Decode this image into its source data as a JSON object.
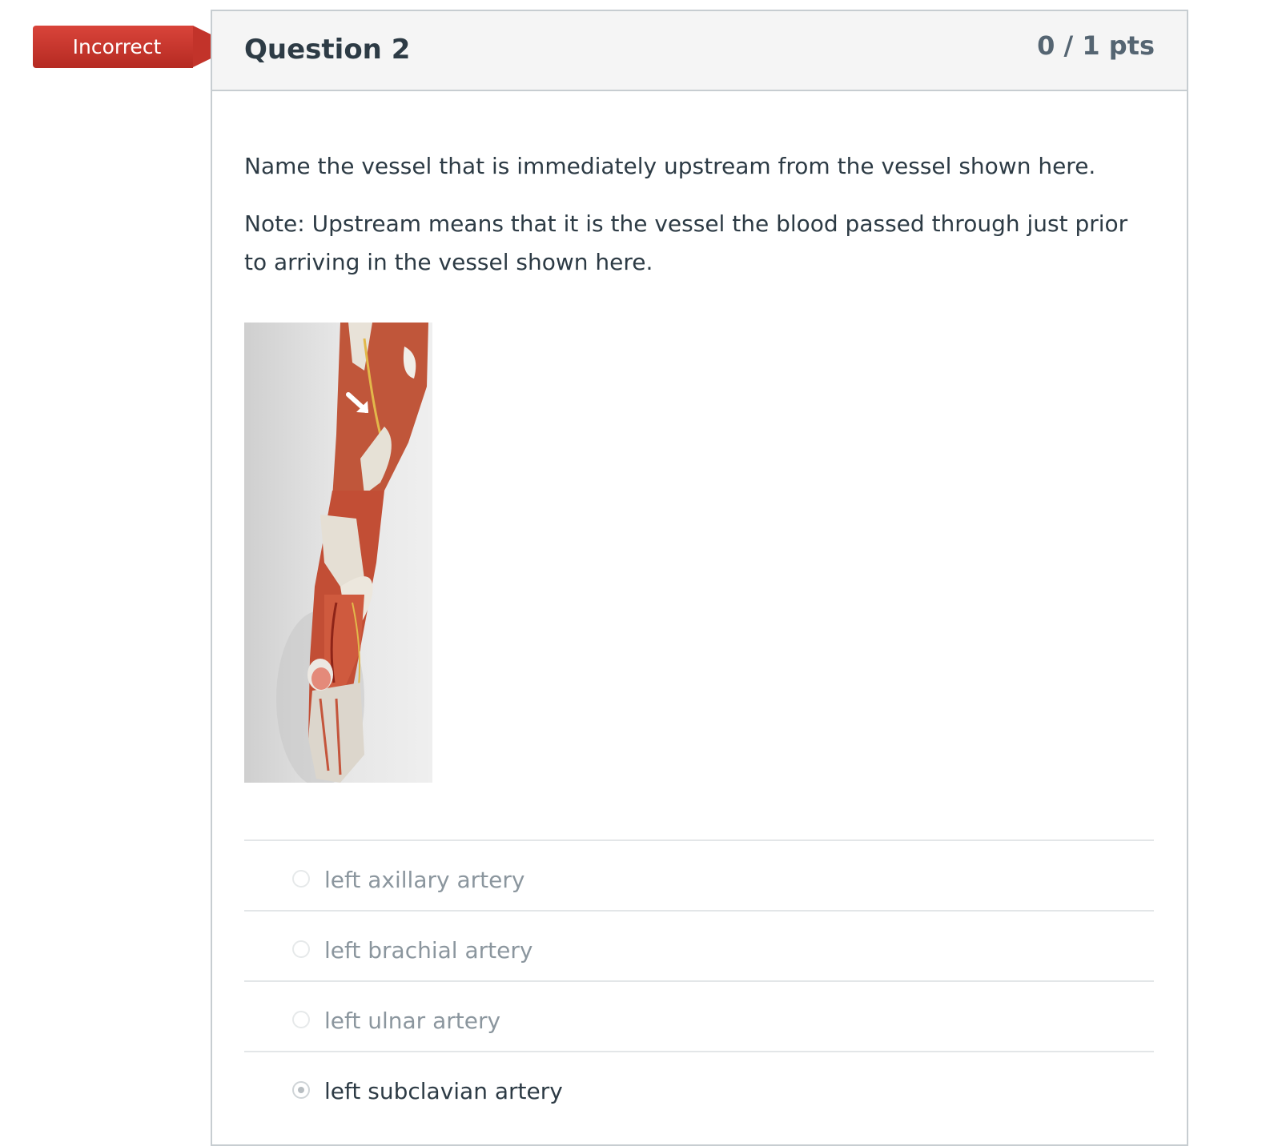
{
  "status": {
    "label": "Incorrect",
    "color": "#c2332a"
  },
  "question": {
    "title": "Question 2",
    "points": "0 / 1 pts",
    "prompt": "Name the vessel that is immediately upstream from the vessel shown here.",
    "note": "Note:  Upstream means that it is the vessel the blood passed through just prior to arriving in the vessel shown here.",
    "figure_icon": "arm-anatomy-model-photo"
  },
  "answers": [
    {
      "label": "left axillary artery",
      "selected": false
    },
    {
      "label": "left brachial artery",
      "selected": false
    },
    {
      "label": "left ulnar artery",
      "selected": false
    },
    {
      "label": "left subclavian artery",
      "selected": true
    }
  ]
}
